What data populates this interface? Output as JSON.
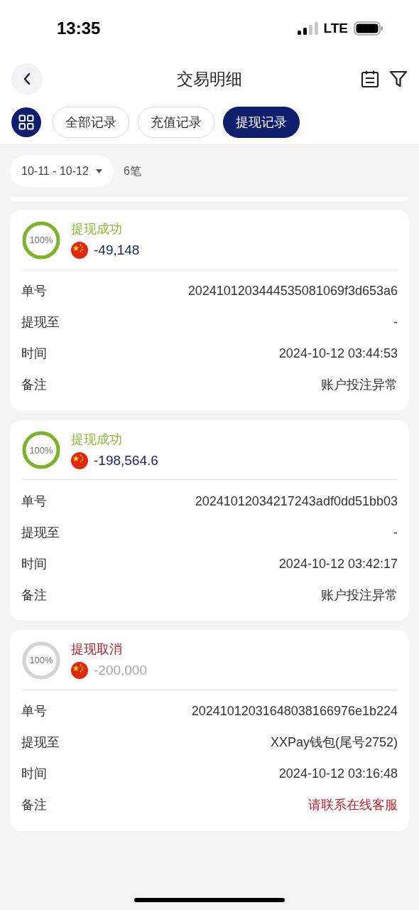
{
  "status_bar": {
    "time": "13:35",
    "network": "LTE"
  },
  "header": {
    "title": "交易明细"
  },
  "tabs": [
    {
      "label": "全部记录",
      "selected": false
    },
    {
      "label": "充值记录",
      "selected": false
    },
    {
      "label": "提现记录",
      "selected": true
    }
  ],
  "filter": {
    "date_range": "10-11 - 10-12",
    "count": "6笔"
  },
  "records": [
    {
      "status": "提现成功",
      "kind": "success",
      "level": 1,
      "percent": "100%",
      "amount": "-49,148",
      "rows": [
        {
          "label": "单号",
          "value": "2024101203444535081069f3d653a6",
          "alert": false
        },
        {
          "label": "提现至",
          "value": "-",
          "alert": false
        },
        {
          "label": "时间",
          "value": "2024-10-12 03:44:53",
          "alert": false
        },
        {
          "label": "备注",
          "value": "账户投注异常",
          "alert": false
        }
      ]
    },
    {
      "status": "提现成功",
      "kind": "success",
      "level": 1,
      "percent": "100%",
      "amount": "-198,564.6",
      "rows": [
        {
          "label": "单号",
          "value": "20241012034217243adf0dd51bb03",
          "alert": false
        },
        {
          "label": "提现至",
          "value": "-",
          "alert": false
        },
        {
          "label": "时间",
          "value": "2024-10-12 03:42:17",
          "alert": false
        },
        {
          "label": "备注",
          "value": "账户投注异常",
          "alert": false
        }
      ]
    },
    {
      "status": "提现取消",
      "kind": "cancelled",
      "level": 1,
      "percent": "100%",
      "amount": "-200,000",
      "rows": [
        {
          "label": "单号",
          "value": "20241012031648038166976e1b224",
          "alert": false
        },
        {
          "label": "提现至",
          "value": "XXPay钱包(尾号2752)",
          "alert": false
        },
        {
          "label": "时间",
          "value": "2024-10-12 03:16:48",
          "alert": false
        },
        {
          "label": "备注",
          "value": "请联系在线客服",
          "alert": true
        }
      ]
    }
  ]
}
